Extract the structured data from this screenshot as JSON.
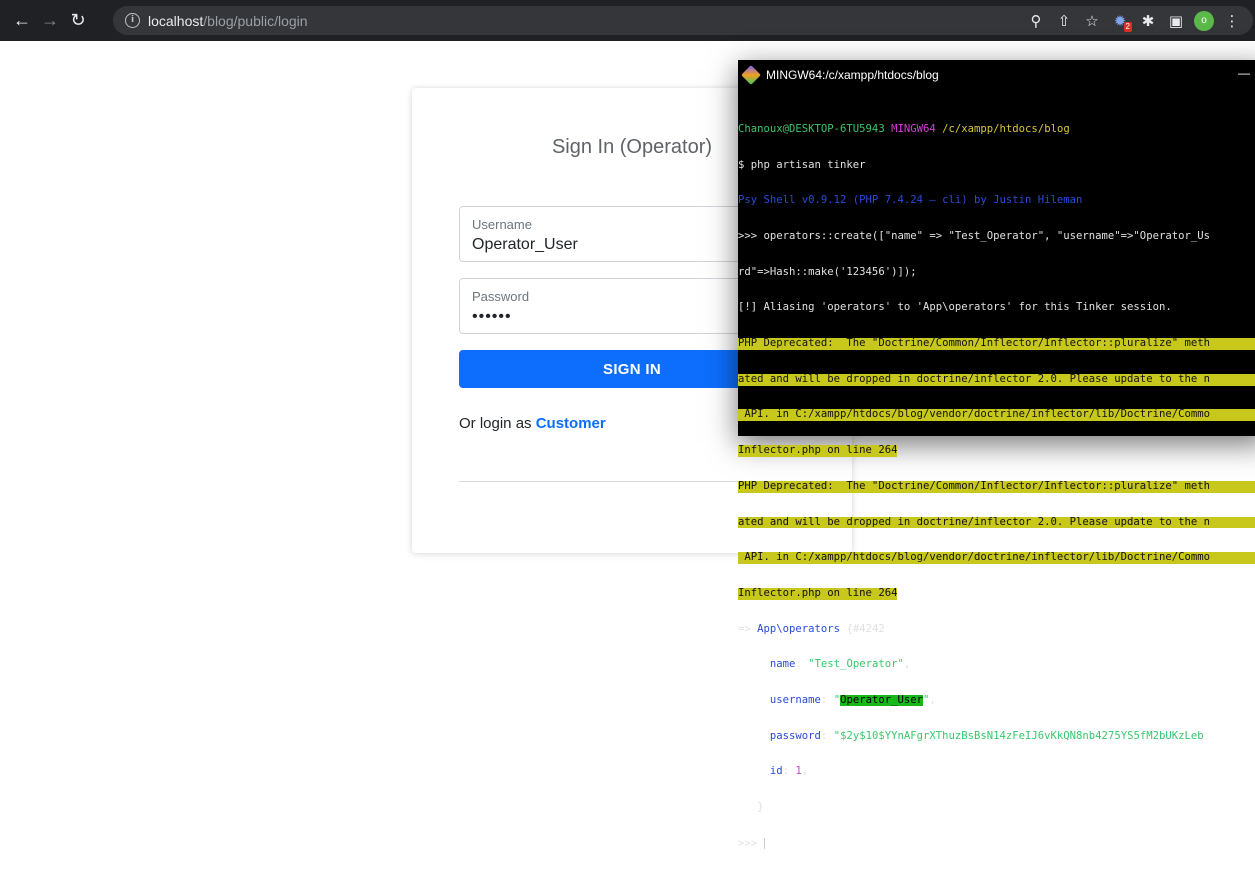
{
  "browser": {
    "url_host": "localhost",
    "url_path": "/blog/public/login",
    "extension_badge": "2",
    "profile_initial": "o",
    "icons": [
      "back-icon",
      "forward-icon",
      "reload-icon",
      "info-icon",
      "key-icon",
      "share-icon",
      "star-icon",
      "extension-icon",
      "puzzle-icon",
      "sidepanel-icon",
      "menu-icon"
    ]
  },
  "login": {
    "title": "Sign In (Operator)",
    "username_label": "Username",
    "username_value": "Operator_User",
    "password_label": "Password",
    "password_value": "••••••",
    "signin_label": "SIGN IN",
    "alt_prefix": "Or login as ",
    "alt_link": "Customer"
  },
  "terminal": {
    "title": "MINGW64:/c/xampp/htdocs/blog",
    "min_glyph": "—",
    "prompt_user": "Chanoux@DESKTOP-6TU5943",
    "prompt_env": "MINGW64",
    "prompt_path": "/c/xampp/htdocs/blog",
    "cmd": "$ php artisan tinker",
    "psysh": "Psy Shell v0.9.12 (PHP 7.4.24 — cli) by Justin Hileman",
    "create_1": ">>> operators::create([\"name\" => \"Test_Operator\", \"username\"=>\"Operator_Us",
    "create_2": "rd\"=>Hash::make('123456')]);",
    "alias": "[!] Aliasing 'operators' to 'App\\operators' for this Tinker session.",
    "dep_1": "PHP Deprecated:  The \"Doctrine/Common/Inflector/Inflector::pluralize\" meth",
    "dep_2": "ated and will be dropped in doctrine/inflector 2.0. Please update to the n",
    "dep_3": " API. in C:/xampp/htdocs/blog/vendor/doctrine/inflector/lib/Doctrine/Commo",
    "dep_4": "Inflector.php on line 264",
    "result_arrow": "=> ",
    "result_class": "App\\operators",
    "result_id": " {#4242",
    "name_key": "name",
    "name_val": "\"Test_Operator\"",
    "username_key": "username",
    "username_val": "Operator_User",
    "password_key": "password",
    "password_val": "\"$2y$10$YYnAFgrXThuzBsBsN14zFeIJ6vKkQN8nb4275YS5fM2bUKzLeb",
    "id_key": "id",
    "id_val": "1",
    "close_brace": "   }",
    "prompt2": ">>> "
  }
}
